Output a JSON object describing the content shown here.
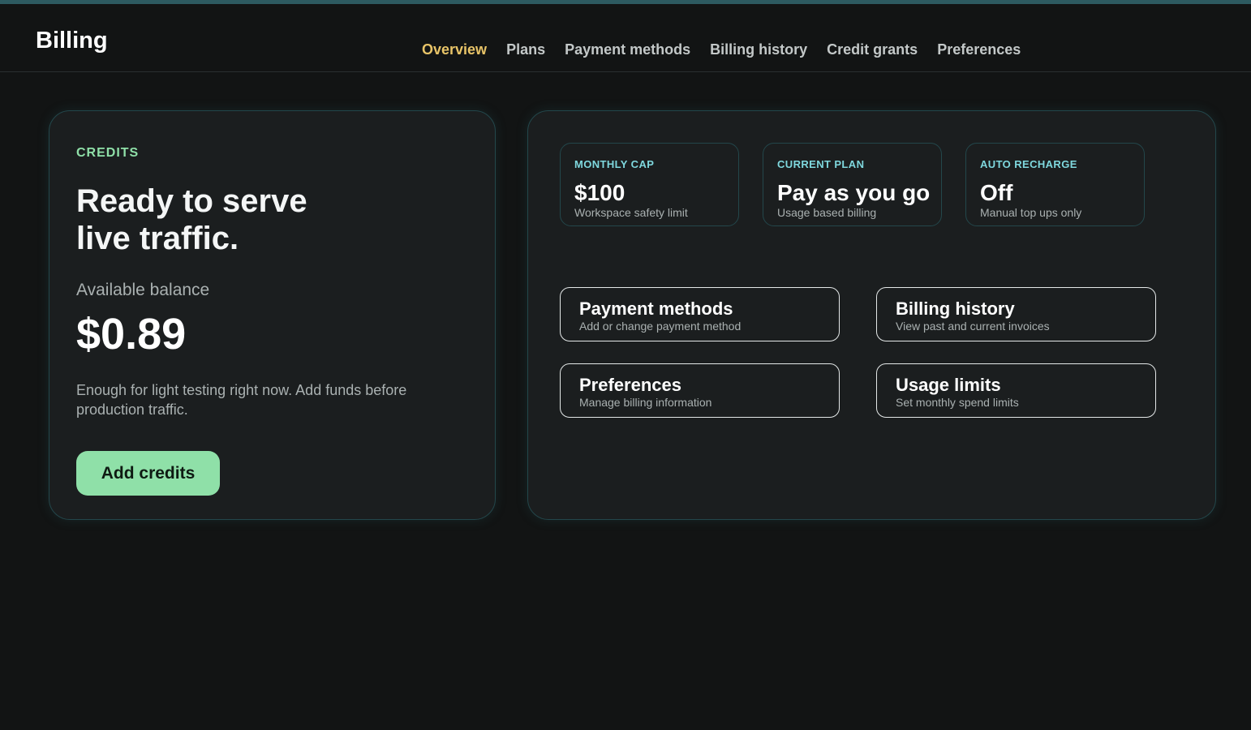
{
  "header": {
    "title": "Billing",
    "tabs": [
      {
        "label": "Overview",
        "active": true
      },
      {
        "label": "Plans",
        "active": false
      },
      {
        "label": "Payment methods",
        "active": false
      },
      {
        "label": "Billing history",
        "active": false
      },
      {
        "label": "Credit grants",
        "active": false
      },
      {
        "label": "Preferences",
        "active": false
      }
    ]
  },
  "credits": {
    "eyebrow": "CREDITS",
    "headline_line1": "Ready to serve",
    "headline_line2": "live traffic.",
    "balance_label": "Available balance",
    "balance_amount": "$0.89",
    "note": "Enough for light testing right now. Add funds before production traffic.",
    "add_button_label": "Add credits"
  },
  "stats": [
    {
      "label": "MONTHLY CAP",
      "value": "$100",
      "sub": "Workspace safety limit"
    },
    {
      "label": "CURRENT PLAN",
      "value": "Pay as you go",
      "sub": "Usage based billing"
    },
    {
      "label": "AUTO RECHARGE",
      "value": "Off",
      "sub": "Manual top ups only"
    }
  ],
  "links": [
    {
      "title": "Payment methods",
      "sub": "Add or change payment method"
    },
    {
      "title": "Billing history",
      "sub": "View past and current invoices"
    },
    {
      "title": "Preferences",
      "sub": "Manage billing information"
    },
    {
      "title": "Usage limits",
      "sub": "Set monthly spend limits"
    }
  ],
  "colors": {
    "background": "#121414",
    "card": "#1b1e1f",
    "card_border": "#23474b",
    "active_tab": "#e8c468",
    "accent_green": "#8fe0a8",
    "stat_label": "#7fd8de"
  }
}
